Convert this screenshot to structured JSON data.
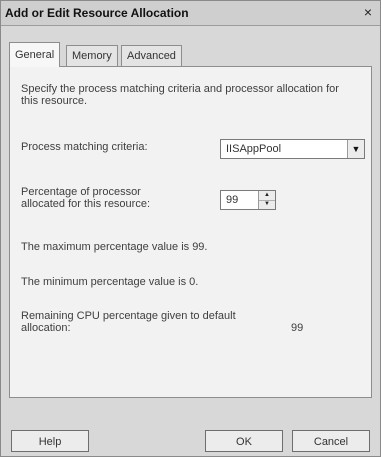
{
  "window": {
    "title": "Add or Edit Resource Allocation",
    "close_glyph": "×"
  },
  "tabs": [
    {
      "label": "General",
      "active": true
    },
    {
      "label": "Memory",
      "active": false
    },
    {
      "label": "Advanced",
      "active": false
    }
  ],
  "general": {
    "description": "Specify the process matching criteria and processor allocation for this resource.",
    "criteria_label": "Process matching criteria:",
    "criteria_value": "IISAppPool",
    "percentage_label": "Percentage of processor allocated for this resource:",
    "percentage_value": "99",
    "max_text": "The maximum percentage value is 99.",
    "min_text": "The minimum percentage value is 0.",
    "remaining_label": "Remaining CPU percentage given to default allocation:",
    "remaining_value": "99"
  },
  "buttons": {
    "help": "Help",
    "ok": "OK",
    "cancel": "Cancel"
  },
  "icons": {
    "dropdown": "chevron-down-icon",
    "spin_up": "triangle-up-icon",
    "spin_down": "triangle-down-icon"
  }
}
